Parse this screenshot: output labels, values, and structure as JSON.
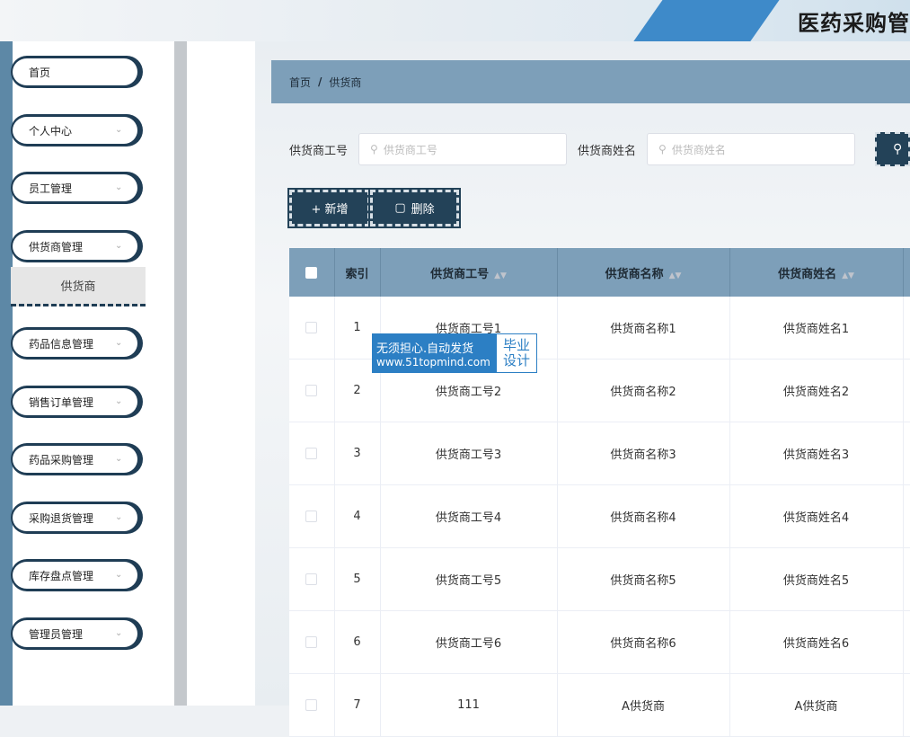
{
  "header": {
    "title": "医药采购管"
  },
  "sidebar": {
    "items": [
      {
        "label": "首页"
      },
      {
        "label": "个人中心"
      },
      {
        "label": "员工管理"
      },
      {
        "label": "供货商管理"
      },
      {
        "label": "药品信息管理"
      },
      {
        "label": "销售订单管理"
      },
      {
        "label": "药品采购管理"
      },
      {
        "label": "采购退货管理"
      },
      {
        "label": "库存盘点管理"
      },
      {
        "label": "管理员管理"
      }
    ],
    "submenu": {
      "label": "供货商"
    }
  },
  "breadcrumb": {
    "home": "首页",
    "separator": "/",
    "current": "供货商"
  },
  "search": {
    "field1_label": "供货商工号",
    "field1_placeholder": "供货商工号",
    "field2_label": "供货商姓名",
    "field2_placeholder": "供货商姓名"
  },
  "actions": {
    "add_label": "+ 新增",
    "delete_label": "删除"
  },
  "table": {
    "headers": [
      "索引",
      "供货商工号",
      "供货商名称",
      "供货商姓名"
    ],
    "rows": [
      [
        "1",
        "供货商工号1",
        "供货商名称1",
        "供货商姓名1"
      ],
      [
        "2",
        "供货商工号2",
        "供货商名称2",
        "供货商姓名2"
      ],
      [
        "3",
        "供货商工号3",
        "供货商名称3",
        "供货商姓名3"
      ],
      [
        "4",
        "供货商工号4",
        "供货商名称4",
        "供货商姓名4"
      ],
      [
        "5",
        "供货商工号5",
        "供货商名称5",
        "供货商姓名5"
      ],
      [
        "6",
        "供货商工号6",
        "供货商名称6",
        "供货商姓名6"
      ],
      [
        "7",
        "111",
        "A供货商",
        "A供货商"
      ]
    ]
  },
  "watermark": {
    "line1": "无须担心.自动发货",
    "line2": "www.51topmind.com",
    "tag1": "毕业",
    "tag2": "设计"
  },
  "colors": {
    "accent": "#7d9fb9",
    "dark": "#234258",
    "watermark": "#2c7fc4"
  }
}
